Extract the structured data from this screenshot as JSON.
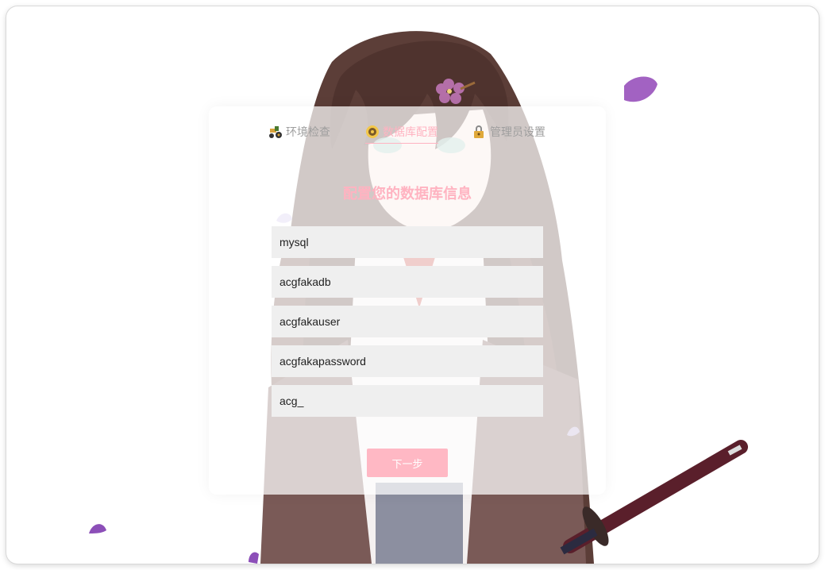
{
  "steps": [
    {
      "icon": "tractor-icon",
      "label": "环境检查"
    },
    {
      "icon": "database-icon",
      "label": "数据库配置"
    },
    {
      "icon": "lock-icon",
      "label": "管理员设置"
    }
  ],
  "active_step": 1,
  "heading": "配置您的数据库信息",
  "form": {
    "db_type": "mysql",
    "db_name": "acgfakadb",
    "db_user": "acgfakauser",
    "db_password": "acgfakapassword",
    "db_prefix": "acg_"
  },
  "next_label": "下一步",
  "colors": {
    "accent": "#ffb3c1",
    "button": "#ffb8c4",
    "field_bg": "#efefef"
  }
}
